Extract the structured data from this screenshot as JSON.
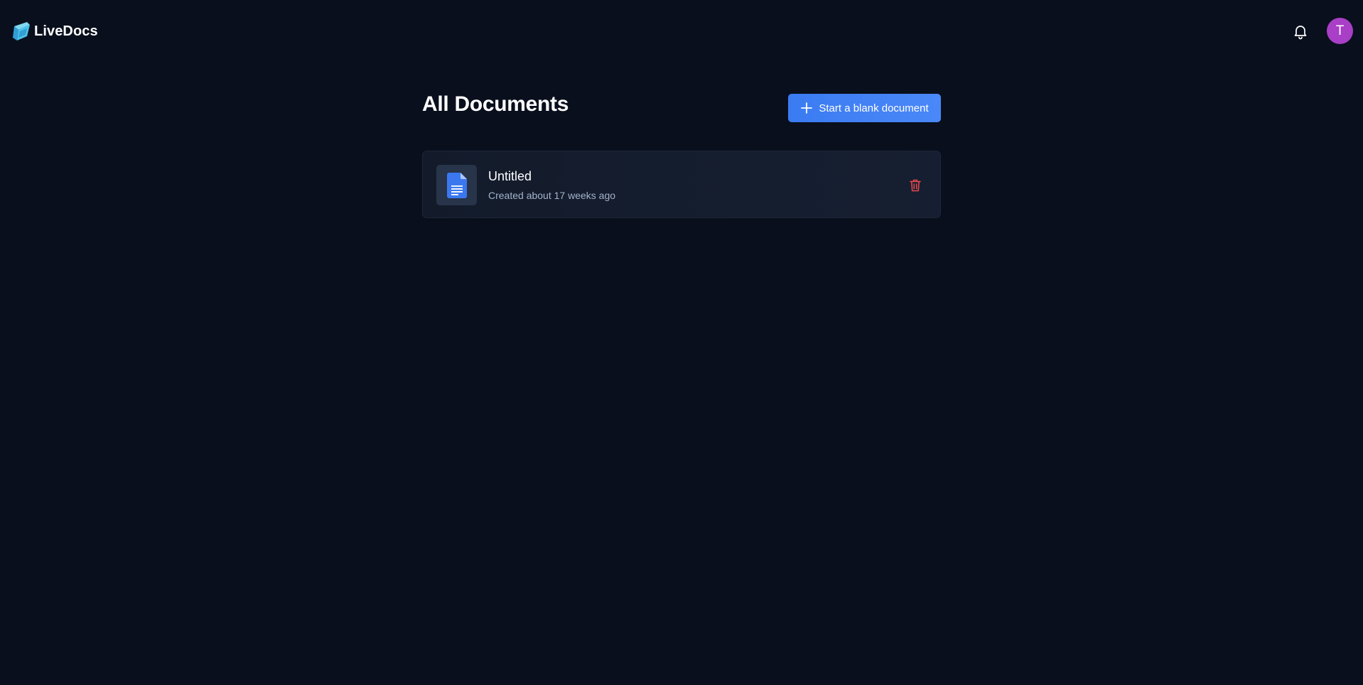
{
  "header": {
    "app_name": "LiveDocs",
    "notification_icon": "bell-icon",
    "avatar_initial": "T",
    "avatar_color": "#a83fc6"
  },
  "main": {
    "title": "All Documents",
    "new_document_label": "Start a blank document",
    "new_document_icon": "plus-icon",
    "documents": [
      {
        "title": "Untitled",
        "meta": "Created about 17 weeks ago",
        "icon": "document-icon",
        "action_icon": "trash-icon"
      }
    ]
  },
  "colors": {
    "background": "#090f1c",
    "card": "#151e2f",
    "accent": "#3b7bf2",
    "danger": "#e5484d",
    "muted_text": "#a3b3cc"
  }
}
